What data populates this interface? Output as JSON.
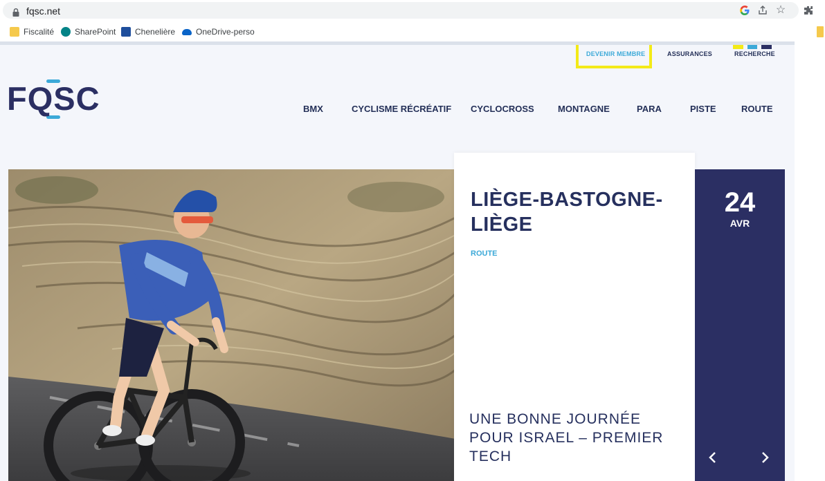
{
  "browser": {
    "url": "fqsc.net",
    "bookmarks": [
      {
        "label": "Fiscalité",
        "icon": "folder-icon",
        "color": "#f5c94c"
      },
      {
        "label": "SharePoint",
        "icon": "sharepoint-icon",
        "color": "#038387"
      },
      {
        "label": "Chenelière",
        "icon": "cheneliere-icon",
        "color": "#1f4e9c"
      },
      {
        "label": "OneDrive-perso",
        "icon": "onedrive-icon",
        "color": "#0a64c8"
      }
    ],
    "icons": [
      "lock-icon",
      "google-icon",
      "share-icon",
      "star-icon",
      "extensions-icon"
    ]
  },
  "site": {
    "logo_text": "FQSC",
    "utility_nav": {
      "devenir_membre": "DEVENIR MEMBRE",
      "assurances": "ASSURANCES",
      "recherche": "RECHERCHE"
    },
    "main_nav": [
      "BMX",
      "CYCLISME RÉCRÉATIF",
      "CYCLOCROSS",
      "MONTAGNE",
      "PARA",
      "PISTE",
      "ROUTE"
    ],
    "article": {
      "title": "LIÈGE-BASTOGNE-LIÈGE",
      "category": "ROUTE",
      "headline": "UNE BONNE JOURNÉE POUR ISRAEL – PREMIER TECH"
    },
    "date": {
      "day": "24",
      "month": "AVR"
    },
    "carousel": {
      "prev_icon": "chevron-left-icon",
      "next_icon": "chevron-right-icon"
    },
    "colors": {
      "navy": "#2b2f63",
      "accent_blue": "#3ca9d8",
      "highlight_yellow": "#f3ea18"
    }
  }
}
